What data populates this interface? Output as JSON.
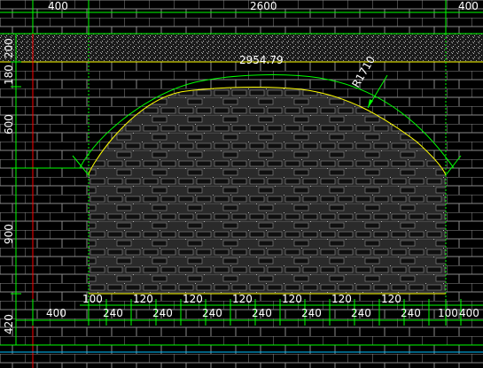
{
  "drawing": {
    "top_dimensions": [
      "400",
      "2600",
      "400"
    ],
    "left_dimensions": [
      "180",
      "200",
      "600",
      "900",
      "420"
    ],
    "arc_length_label": "2954.79",
    "radius_label": "R1710",
    "bottom_small_dimensions": [
      "100",
      "120",
      "120",
      "120",
      "120",
      "120",
      "120"
    ],
    "bottom_dimensions": [
      "400",
      "240",
      "240",
      "240",
      "240",
      "240",
      "240",
      "240",
      "240",
      "100",
      "400"
    ]
  },
  "colors": {
    "background": "#000000",
    "dimension_lines": "#00ff00",
    "arch_line": "#ffff00",
    "brick_lines": "#8a8a8a",
    "center_line": "#ff0000",
    "hatch": "#9c9c9c",
    "text": "#ffffff",
    "baseline": "#00bfff"
  }
}
